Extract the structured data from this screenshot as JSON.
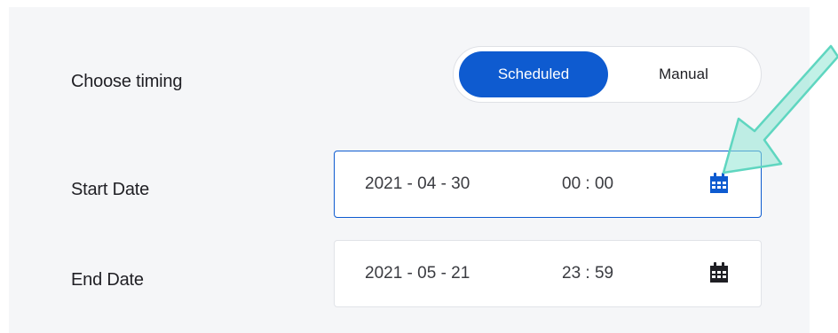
{
  "timing": {
    "label": "Choose timing",
    "options": [
      {
        "label": "Scheduled",
        "selected": true
      },
      {
        "label": "Manual",
        "selected": false
      }
    ]
  },
  "start": {
    "label": "Start Date",
    "date": "2021 - 04 - 30",
    "time": "00 : 00",
    "icon": "calendar-icon",
    "icon_color": "#0e5bd0",
    "focused": true
  },
  "end": {
    "label": "End Date",
    "date": "2021 - 05 - 21",
    "time": "23 : 59",
    "icon": "calendar-icon",
    "icon_color": "#1f1f24"
  },
  "colors": {
    "accent": "#0e5bd0",
    "panel_bg": "#f5f6f8",
    "annotation_arrow": "#8fe5d3"
  },
  "annotation": {
    "icon": "arrow-annotation",
    "target": "start-date-calendar-button"
  }
}
